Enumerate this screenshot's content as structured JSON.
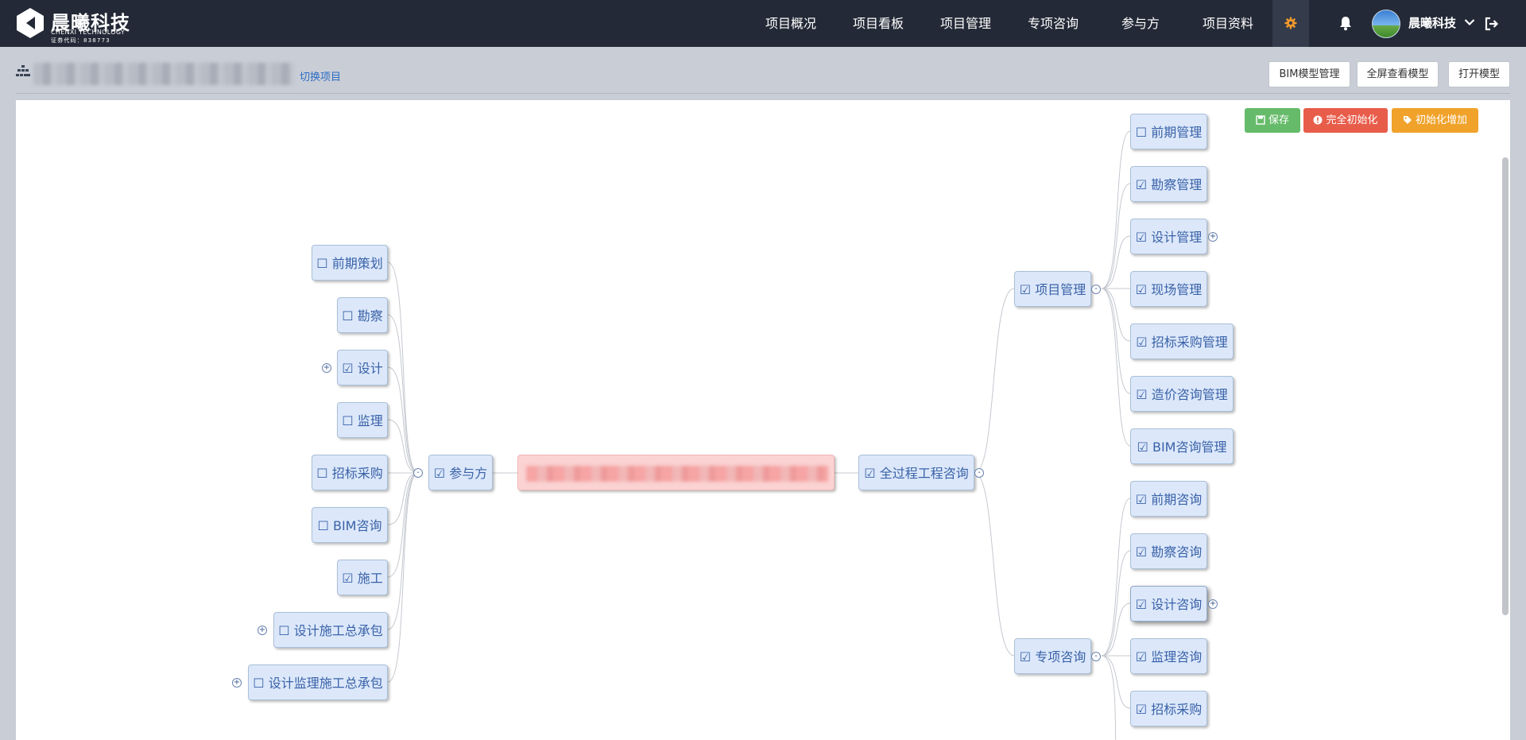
{
  "header": {
    "logo": {
      "name": "晨曦科技",
      "en": "CHENXI TECHNOLOGY",
      "code": "证券代码：838773"
    },
    "nav": [
      {
        "label": "项目概况"
      },
      {
        "label": "项目看板"
      },
      {
        "label": "项目管理"
      },
      {
        "label": "专项咨询"
      },
      {
        "label": "参与方"
      },
      {
        "label": "项目资料"
      }
    ],
    "username": "晨曦科技"
  },
  "subheader": {
    "switch_project": "切换项目",
    "buttons": {
      "bim": "BIM模型管理",
      "fullscreen": "全屏查看模型",
      "open": "打开模型"
    }
  },
  "actions": {
    "save": "保存",
    "full_reset": "完全初始化",
    "reset_add": "初始化增加"
  },
  "mindmap": {
    "participants": {
      "label": "☑ 参与方",
      "toggle": "-"
    },
    "consult": {
      "label": "☑ 全过程工程咨询",
      "toggle": "-"
    },
    "left_nodes": [
      {
        "label": "☐ 前期策划"
      },
      {
        "label": "☐ 勘察"
      },
      {
        "label": "☑ 设计",
        "toggle": "+"
      },
      {
        "label": "☐ 监理"
      },
      {
        "label": "☐ 招标采购"
      },
      {
        "label": "☐ BIM咨询"
      },
      {
        "label": "☑ 施工"
      },
      {
        "label": "☐ 设计施工总承包",
        "toggle": "+"
      },
      {
        "label": "☐ 设计监理施工总承包",
        "toggle": "+"
      }
    ],
    "project_mgmt": {
      "label": "☑ 项目管理",
      "toggle": "-",
      "children": [
        {
          "label": "☐ 前期管理"
        },
        {
          "label": "☑ 勘察管理"
        },
        {
          "label": "☑ 设计管理",
          "toggle": "+"
        },
        {
          "label": "☑ 现场管理"
        },
        {
          "label": "☑ 招标采购管理"
        },
        {
          "label": "☑ 造价咨询管理"
        },
        {
          "label": "☑ BIM咨询管理"
        }
      ]
    },
    "special_consult": {
      "label": "☑ 专项咨询",
      "toggle": "-",
      "children": [
        {
          "label": "☑ 前期咨询"
        },
        {
          "label": "☑ 勘察咨询"
        },
        {
          "label": "☑ 设计咨询",
          "toggle": "+"
        },
        {
          "label": "☑ 监理咨询"
        },
        {
          "label": "☑ 招标采购"
        }
      ]
    }
  },
  "colors": {
    "topbar": "#232936",
    "node_bg": "#dce8fa",
    "node_text": "#3a62a8",
    "root_bg": "#fbd3d3",
    "save": "#66bb6a",
    "reset": "#e85c4a",
    "add": "#f0a22a",
    "gear": "#f39a2b"
  }
}
